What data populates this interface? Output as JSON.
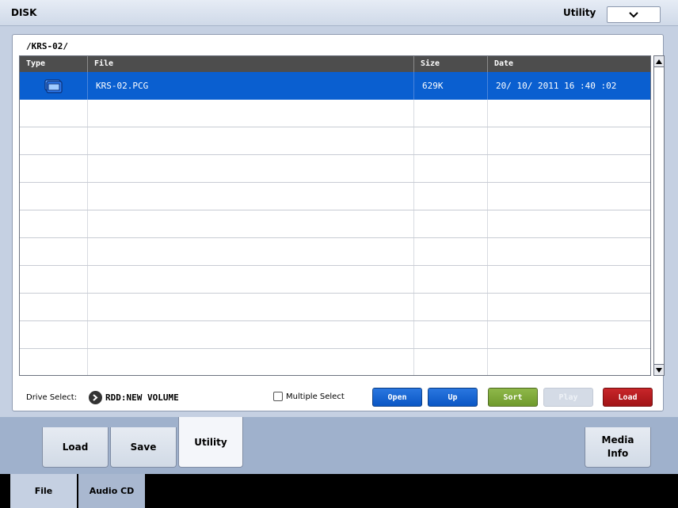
{
  "header": {
    "title": "DISK",
    "page_menu_label": "Utility",
    "page_menu_icon": "chevron-down-icon"
  },
  "panel": {
    "path": "/KRS-02/",
    "columns": [
      "Type",
      "File",
      "Size",
      "Date"
    ],
    "rows": [
      {
        "type_icon": "folder-icon",
        "file": "KRS-02.PCG",
        "size": "629K",
        "date": "20/ 10/ 2011   16 :40 :02",
        "selected": true
      }
    ],
    "empty_row_count": 11,
    "drive_select_label": "Drive Select:",
    "drive_select_value": "RDD:NEW VOLUME",
    "multiple_select_label": "Multiple Select",
    "buttons": {
      "open": "Open",
      "up": "Up",
      "sort": "Sort",
      "play": "Play",
      "load": "Load"
    }
  },
  "tabs": {
    "load": "Load",
    "save": "Save",
    "utility": "Utility",
    "media_info_line1": "Media",
    "media_info_line2": "Info"
  },
  "bottom_tabs": {
    "file": "File",
    "audio_cd": "Audio CD"
  },
  "colors": {
    "selected_row": "#0a5fd0",
    "button_blue": "#0a56c4",
    "button_green": "#7aa537",
    "button_red": "#b0181c"
  }
}
